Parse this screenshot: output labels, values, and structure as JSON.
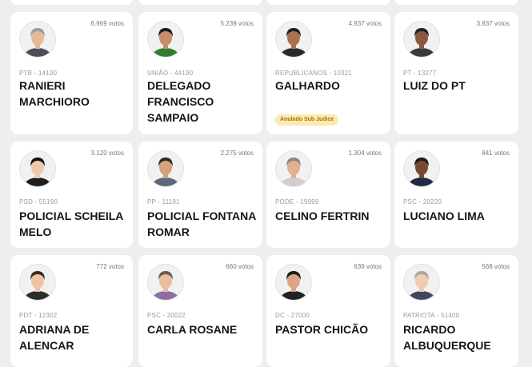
{
  "candidates": [
    {
      "votes": "6.969 votos",
      "party": "PTB - 14100",
      "name": "RANIERI MARCHIORO",
      "avatar": "person-avatar-icon"
    },
    {
      "votes": "5.239 votos",
      "party": "UNIÃO - 44190",
      "name": "DELEGADO FRANCISCO SAMPAIO",
      "avatar": "person-avatar-icon"
    },
    {
      "votes": "4.937 votos",
      "party": "REPUBLICANOS - 10321",
      "name": "GALHARDO",
      "avatar": "person-avatar-icon",
      "badge": "Anulado Sub Judice"
    },
    {
      "votes": "3.837 votos",
      "party": "PT - 13277",
      "name": "LUIZ DO PT",
      "avatar": "person-avatar-icon"
    },
    {
      "votes": "3.120 votos",
      "party": "PSD - 55190",
      "name": "POLICIAL SCHEILA MELO",
      "avatar": "person-avatar-icon"
    },
    {
      "votes": "2.275 votos",
      "party": "PP - 11191",
      "name": "POLICIAL FONTANA ROMAR",
      "avatar": "person-avatar-icon"
    },
    {
      "votes": "1.304 votos",
      "party": "PODE - 19999",
      "name": "CELINO FERTRIN",
      "avatar": "person-avatar-icon"
    },
    {
      "votes": "841 votos",
      "party": "PSC - 20220",
      "name": "LUCIANO LIMA",
      "avatar": "person-avatar-icon"
    },
    {
      "votes": "772 votos",
      "party": "PDT - 12302",
      "name": "ADRIANA DE ALENCAR",
      "avatar": "person-avatar-icon"
    },
    {
      "votes": "660 votos",
      "party": "PSC - 20022",
      "name": "CARLA ROSANE",
      "avatar": "person-avatar-icon"
    },
    {
      "votes": "639 votos",
      "party": "DC - 27000",
      "name": "PASTOR CHICÃO",
      "avatar": "person-avatar-icon"
    },
    {
      "votes": "568 votos",
      "party": "PATRIOTA - 51400",
      "name": "RICARDO ALBUQUERQUE",
      "avatar": "person-avatar-icon"
    }
  ],
  "colors": {
    "background": "#eeeeef",
    "card": "#ffffff",
    "badge_bg": "#fbeab1",
    "badge_text": "#a77400"
  }
}
